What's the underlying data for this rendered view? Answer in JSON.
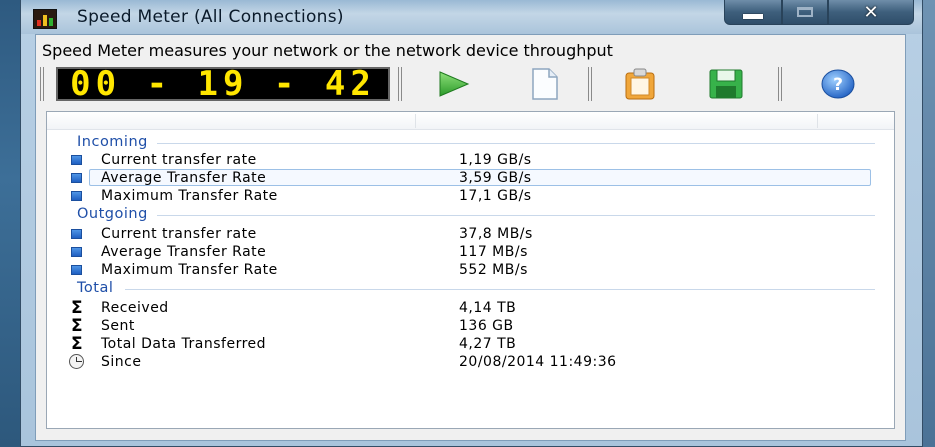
{
  "window": {
    "title": "Speed Meter (All Connections)",
    "close_glyph": "✕"
  },
  "app": {
    "description": "Speed Meter measures your network or the network device throughput",
    "elapsed_time": "00 - 19 - 42"
  },
  "toolbar": {
    "buttons": [
      {
        "name": "play-icon"
      },
      {
        "name": "new-document-icon"
      },
      {
        "name": "clipboard-icon"
      },
      {
        "name": "save-icon"
      },
      {
        "name": "help-icon"
      }
    ]
  },
  "groups": {
    "incoming": {
      "title": "Incoming",
      "rows": [
        {
          "label": "Current transfer rate",
          "value": "1,19 GB/s"
        },
        {
          "label": "Average Transfer Rate",
          "value": "3,59 GB/s"
        },
        {
          "label": "Maximum Transfer Rate",
          "value": "17,1 GB/s"
        }
      ]
    },
    "outgoing": {
      "title": "Outgoing",
      "rows": [
        {
          "label": "Current transfer rate",
          "value": "37,8 MB/s"
        },
        {
          "label": "Average Transfer Rate",
          "value": "117 MB/s"
        },
        {
          "label": "Maximum Transfer Rate",
          "value": "552 MB/s"
        }
      ]
    },
    "total": {
      "title": "Total",
      "rows": [
        {
          "label": "Received",
          "value": "4,14 TB"
        },
        {
          "label": "Sent",
          "value": "136 GB"
        },
        {
          "label": "Total Data Transferred",
          "value": "4,27 TB"
        },
        {
          "label": "Since",
          "value": "20/08/2014 11:49:36"
        }
      ],
      "sigma": "Σ"
    }
  },
  "colors": {
    "clock_digits": "#ffe600",
    "group_title": "#1f4fa8",
    "bullet": "#2f74d8"
  }
}
